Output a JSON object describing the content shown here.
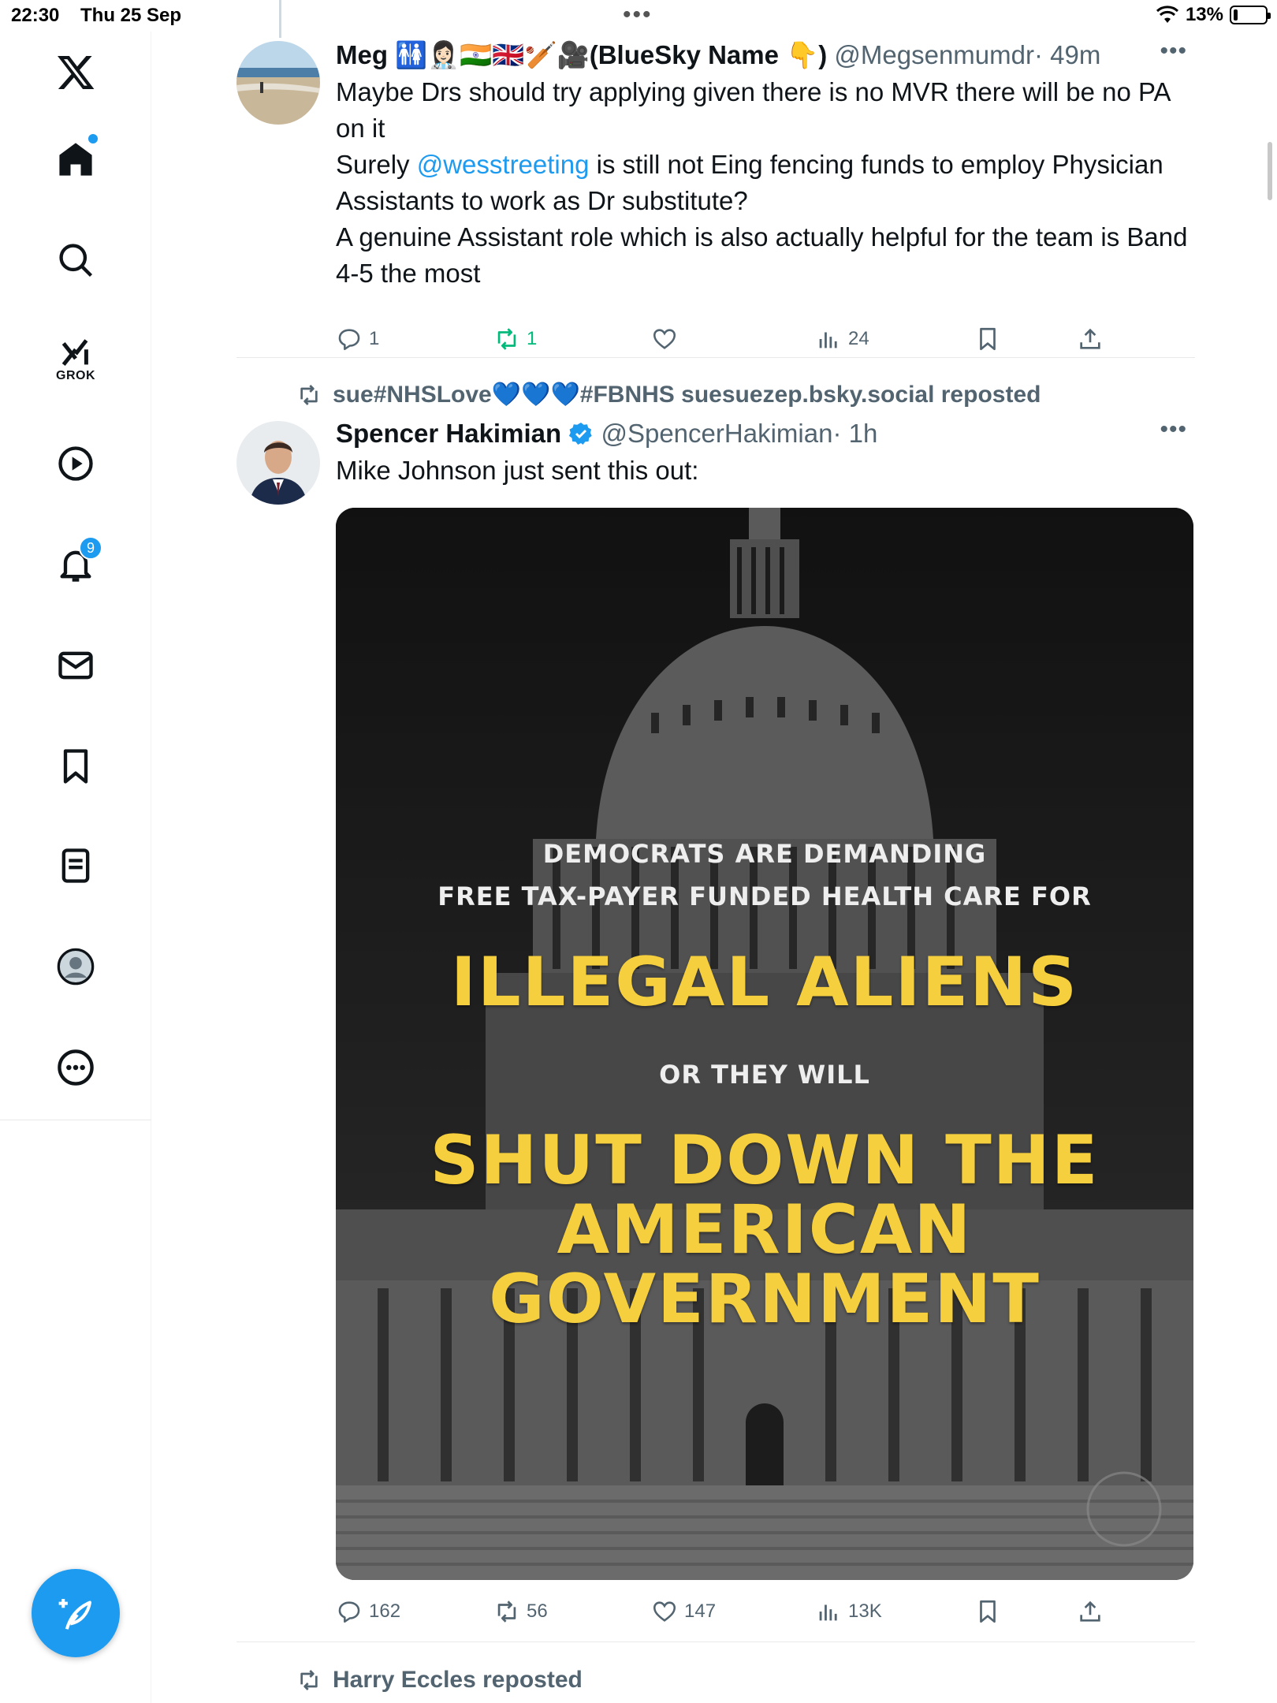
{
  "status_bar": {
    "time": "22:30",
    "date": "Thu 25 Sep",
    "battery_text": "13%",
    "battery_level": 0.13
  },
  "sidebar": {
    "items": [
      {
        "name": "x-logo-icon"
      },
      {
        "name": "home-icon"
      },
      {
        "name": "search-icon"
      },
      {
        "name": "grok-icon",
        "label": "GROK"
      },
      {
        "name": "video-icon"
      },
      {
        "name": "notifications-icon",
        "badge": "9"
      },
      {
        "name": "messages-icon"
      },
      {
        "name": "bookmarks-icon"
      },
      {
        "name": "lists-icon"
      },
      {
        "name": "profile-icon"
      },
      {
        "name": "more-icon"
      }
    ],
    "compose_icon": "compose-feather-icon"
  },
  "tweets": [
    {
      "name": "Meg 🚻👩🏻‍⚕️🇮🇳🇬🇧🏏🎥(BlueSky Name 👇)",
      "handle": "@Megsenmumdr",
      "time": "· 49m",
      "text_lines": [
        "Maybe Drs should try applying given there is no MVR there will be no PA on it",
        "Surely ",
        "@wesstreeting",
        " is still not Eing fencing funds to employ Physician Assistants to work as Dr substitute?",
        "A genuine Assistant role which is also actually helpful for the team is Band 4-5 the most"
      ],
      "replies": "1",
      "reposts": "1",
      "likes": "",
      "views": "24"
    },
    {
      "repost_by": "sue#NHSLove💙💙💙#FBNHS suesuezep.bsky.social reposted",
      "name": "Spencer Hakimian",
      "verified": true,
      "handle": "@SpencerHakimian",
      "time": "· 1h",
      "text": "Mike Johnson just sent this out:",
      "image_text": {
        "line1": "DEMOCRATS ARE DEMANDING",
        "line2": "FREE TAX-PAYER FUNDED HEALTH CARE FOR",
        "line3": "ILLEGAL ALIENS",
        "line4": "OR THEY WILL",
        "line5": "SHUT DOWN THE",
        "line6": "AMERICAN",
        "line7": "GOVERNMENT"
      },
      "replies": "162",
      "reposts": "56",
      "likes": "147",
      "views": "13K"
    },
    {
      "repost_by": "Harry Eccles reposted"
    }
  ],
  "colors": {
    "accent": "#1d9bf0",
    "repost_green": "#00ba7c",
    "muted": "#536471",
    "headline_yellow": "#f5cf3d"
  }
}
